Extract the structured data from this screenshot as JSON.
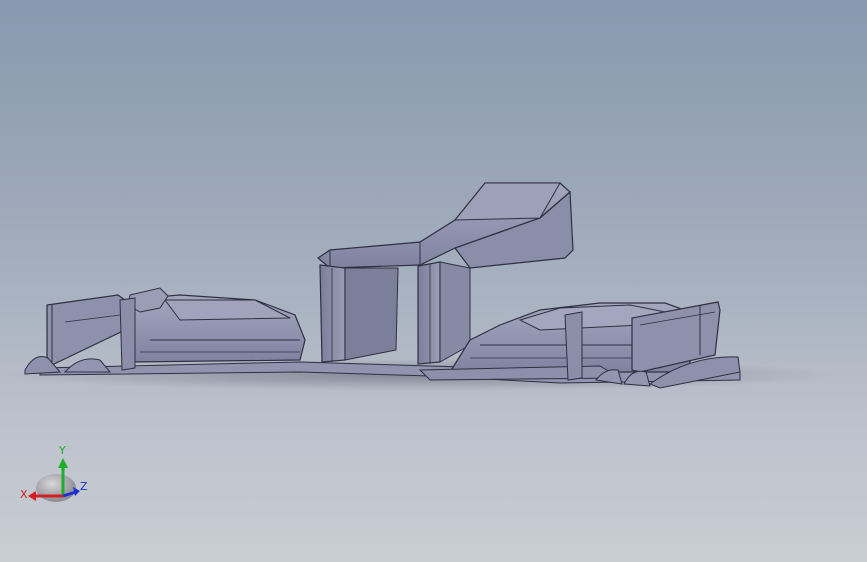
{
  "viewport": {
    "background_top": "#8898ae",
    "background_bottom": "#c9cdd4",
    "model_fill": "#8f93ad",
    "model_fill_light": "#a7aac0",
    "model_fill_dark": "#6f7390",
    "edge_color": "#2e3042"
  },
  "triad": {
    "x_label": "X",
    "y_label": "Y",
    "z_label": "Z",
    "x_color": "#d42020",
    "y_color": "#1fae2c",
    "z_color": "#2030d0"
  }
}
